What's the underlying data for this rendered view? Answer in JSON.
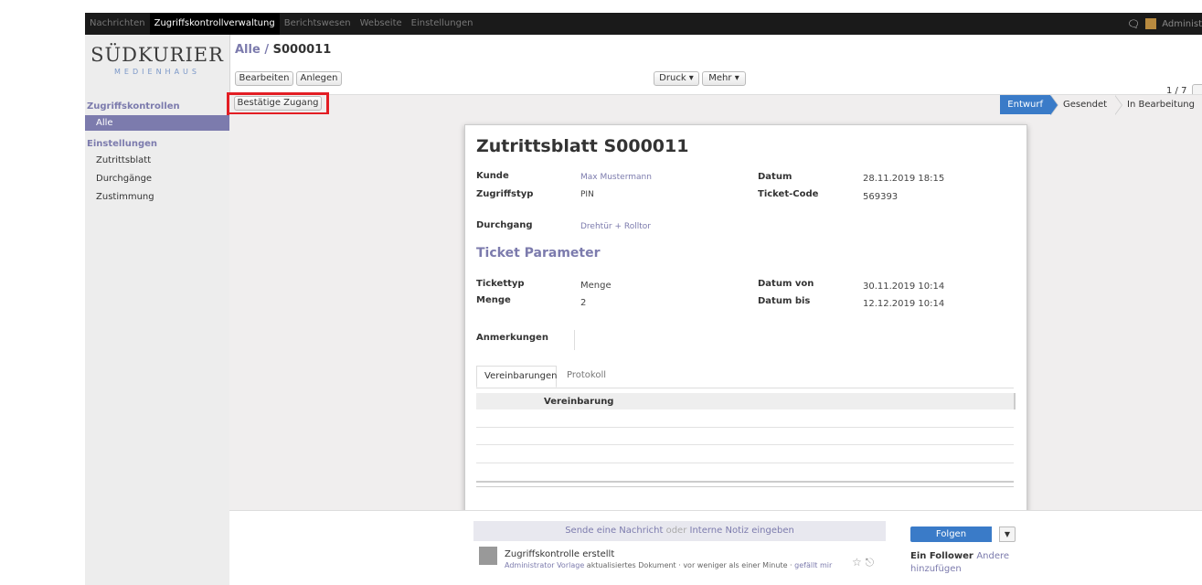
{
  "topmenu": {
    "items": [
      "Nachrichten",
      "Zugriffskontrollverwaltung",
      "Berichtswesen",
      "Webseite",
      "Einstellungen"
    ],
    "active_index": 1,
    "user": "Administ"
  },
  "logo": {
    "line1": "SÜDKURIER",
    "line2": "MEDIENHAUS"
  },
  "sidebar": {
    "section1": "Zugriffskontrollen",
    "item_alle": "Alle",
    "section2": "Einstellungen",
    "items": [
      "Zutrittsblatt",
      "Durchgänge",
      "Zustimmung"
    ]
  },
  "breadcrumb": {
    "parent": "Alle",
    "separator": "/",
    "current": "S000011"
  },
  "buttons": {
    "edit": "Bearbeiten",
    "create": "Anlegen",
    "print": "Druck ▾",
    "more": "Mehr ▾",
    "confirm": "Bestätige Zugang"
  },
  "pager": "1 / 7",
  "statusbar": {
    "states": [
      "Entwurf",
      "Gesendet",
      "In Bearbeitung"
    ],
    "active_index": 0
  },
  "form": {
    "title": "Zutrittsblatt S000011",
    "fields": {
      "kunde_label": "Kunde",
      "kunde_value": "Max Mustermann",
      "zugriffstyp_label": "Zugriffstyp",
      "zugriffstyp_value": "PIN",
      "datum_label": "Datum",
      "datum_value": "28.11.2019 18:15",
      "ticket_code_label": "Ticket-Code",
      "ticket_code_value": "569393",
      "durchgang_label": "Durchgang",
      "durchgang_value": "Drehtür + Rolltor"
    },
    "ticket_section": "Ticket Parameter",
    "ticket": {
      "tickettyp_label": "Tickettyp",
      "tickettyp_value": "Menge",
      "menge_label": "Menge",
      "menge_value": "2",
      "datum_von_label": "Datum von",
      "datum_von_value": "30.11.2019 10:14",
      "datum_bis_label": "Datum bis",
      "datum_bis_value": "12.12.2019 10:14"
    },
    "anmerkungen_label": "Anmerkungen",
    "tabs": [
      "Vereinbarungen",
      "Protokoll"
    ],
    "table_header": "Vereinbarung"
  },
  "chatter": {
    "send_message": "Sende eine Nachricht",
    "or": "oder",
    "internal_note": "Interne Notiz eingeben",
    "message_title": "Zugriffskontrolle erstellt",
    "message_author": "Administrator Vorlage",
    "message_text": "aktualisiertes Dokument · vor weniger als einer Minute ·",
    "message_like": "gefällt mir",
    "follow": "Folgen",
    "followers_count": "Ein Follower",
    "add_others": "Andere hinzufügen"
  },
  "colors": {
    "accent": "#7c7bad",
    "primary": "#3a7bc8",
    "highlight": "#e31e24"
  }
}
